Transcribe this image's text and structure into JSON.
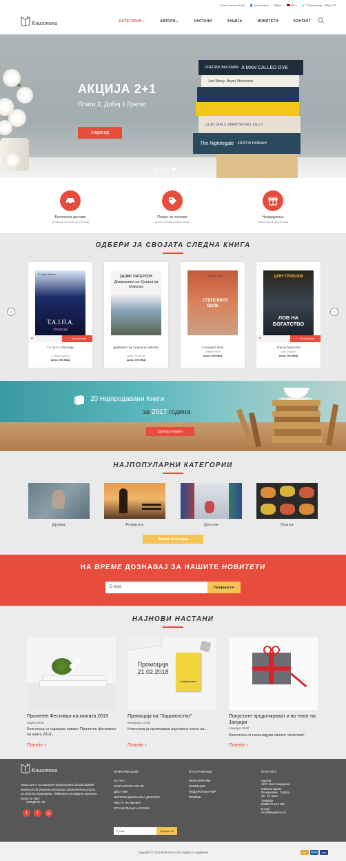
{
  "topbar": {
    "wishlist": "Листа на желби (0)",
    "profile": "Мој профил",
    "currency": "МКД",
    "language": "МК",
    "cart": "0 Производи - МКД 0.00"
  },
  "header": {
    "logo": "Книготека",
    "nav": [
      "КАТЕГОРИИ",
      "АВТОРИ",
      "НАСТАНИ",
      "АКЦИЈА",
      "НОВИТЕТИ",
      "КОНТАКТ"
    ]
  },
  "hero": {
    "title": "АКЦИЈА 2+1",
    "subtitle": "Плати 2, Добиј 1 Гратис",
    "button": "Нарачај",
    "books": [
      "FREDRIK BACKMAN",
      "A MAN CALLED OVE",
      "Just Mercy",
      "Bryan Stevenson",
      "LILAC GIRLS",
      "MARTHA HALL KELLY",
      "The Nightingale",
      "KRISTIN HANNAH"
    ]
  },
  "features": [
    {
      "title": "Бесплатна достава",
      "sub": "За нарачки поголеми од 1000 МКД"
    },
    {
      "title": "Попуст за членови",
      "sub": "За сите членови следува попуст"
    },
    {
      "title": "Наградување",
      "sub": "Секоја недела нова награда"
    }
  ],
  "choose": {
    "title": "ОДБЕРИ ЈА СВОЈАТА СЛЕДНА КНИГА",
    "cart_label": "Во кошничка",
    "books": [
      {
        "title": "Т.А.Ј.Н.А. Опсесија",
        "author": "Л. Мари Аделин",
        "price": "Цена: 390 МКД",
        "cover_author": "Л. Мари Аделин",
        "cover_title": "Т.А.Ј.Н.А.",
        "cover_sub": "Опсесија"
      },
      {
        "title": "Дневникот на Сузана за Николас",
        "author": "Џејмс Патерсон",
        "price": "Цена: 399 МКД",
        "cover_author": "ЏЕЈМС ПАТЕРСОН",
        "cover_title": "Дневникот на Сузана за Николас"
      },
      {
        "title": "Степскиот волк",
        "author": "Херман Хесе",
        "price": "Цена: 699 МКД",
        "cover_author": "ХЕРМАН ХЕСЕ",
        "cover_title": "СТЕПСКИОТ ВОЛК"
      },
      {
        "title": "Лов на богатство",
        "author": "Џон Гришам",
        "price": "Цена: 300 МКД",
        "cover_author": "ЏОН ГРИШАМ",
        "cover_title": "ЛОВ НА БОГАТСТВО"
      }
    ]
  },
  "banner": {
    "title": "20 Најпродавани Книги",
    "sub_pre": "за",
    "sub_year": "2017",
    "sub_post": "година",
    "button": "Дознај повеќе"
  },
  "categories": {
    "title": "НАЈПОПУЛАРНИ КАТЕГОРИИ",
    "items": [
      "Драма",
      "Романса",
      "Детски",
      "Храна"
    ],
    "button": "Повеќе Категории"
  },
  "newsletter": {
    "title_a": "НА",
    "title_b": "ВРЕМЕ",
    "title_c": "ДОЗНАВАЈ ЗА НАШИТЕ",
    "title_d": "НОВИТЕТИ",
    "placeholder": "E-mail",
    "button": "Пријави се"
  },
  "events": {
    "title": "НАЈНОВИ НАСТАНИ",
    "items": [
      {
        "title": "Пролетен Фестивал на книгата 2018",
        "date": "Март 2018",
        "text": "Книготека го најавува новиот Пролетен фестивал на книга 2018...",
        "more": "Повеќе"
      },
      {
        "title": "Промоција на \"Задоволство\"",
        "date": "Февруари 2018",
        "text": "Книготека ја промовира најновата книга на...",
        "more": "Повеќе",
        "img_text": "Промоција 21.02.2018",
        "book_text": "ЗАДОВОЛСТВО"
      },
      {
        "title": "Попустите продолжуваат и во текот на Јануари",
        "date": "Јануари 2018",
        "text": "Книготека ги изненадува своите читатели!",
        "more": "Повеќе"
      }
    ]
  },
  "footer": {
    "logo": "Книготека",
    "about": "Наша цел е на нашите потрошувачи да им дадеме можност да уживаат во високо квалитетни услуги со одлични производи. Одберете ја својата омилена книга со Нас!",
    "follow": "СЛЕДЕТЕ НЕ",
    "info_title": "ИНФОРМАЦИИ",
    "info": [
      "ЗА НАС",
      "КОНТАКТИРАЈТЕ НЕ",
      "ДОСТАВА",
      "ИНТЕРНАЦИОНАЛНА ДОСТАВА",
      "ЛИСТА НА ЖЕЛБИ",
      "ОТКАЖУВАЊЕ НАРАЧКА"
    ],
    "shop_title": "ПАЗАРУВАЊЕ",
    "shop": [
      "МОИ НАРАЧКИ",
      "КОЛЕКЦИИ",
      "ПОДАРОК ВАУЧЕР",
      "ПОМОШ"
    ],
    "contact_title": "КОНТАКТ",
    "contact": [
      "Адреса",
      "1107 Јане Сандански",
      "Работно време",
      "Понеделник - Сабота",
      "10 - 21 часот",
      "Телефон",
      "00389 70 123 456",
      "E-mail",
      "info@knigoteka.mk"
    ],
    "email_placeholder": "E-mail",
    "subscribe": "Пријави се",
    "copyright": "Copyright © 2018 Книготека Сите права се задржани",
    "payments": [
      "MC",
      "Maestro",
      "VISA"
    ]
  }
}
